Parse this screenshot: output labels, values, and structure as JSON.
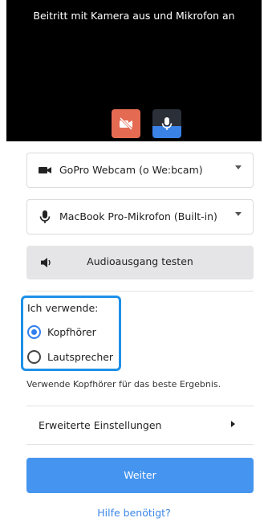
{
  "preview": {
    "title": "Beitritt mit Kamera aus und Mikrofon an",
    "camera_icon": "camera-off-icon",
    "mic_icon": "microphone-icon",
    "camera_button_color": "#e46b52",
    "mic_button_active_color": "#3b82e6"
  },
  "devices": {
    "camera_select": {
      "value": "GoPro Webcam (o We:bcam)",
      "icon": "video-camera-icon"
    },
    "microphone_select": {
      "value": "MacBook Pro-Mikrofon (Built-in)",
      "icon": "microphone-icon"
    },
    "audio_test": {
      "label": "Audioausgang testen",
      "icon": "speaker-icon"
    }
  },
  "usage": {
    "title": "Ich verwende:",
    "options": [
      {
        "label": "Kopfhörer",
        "selected": true
      },
      {
        "label": "Lautsprecher",
        "selected": false
      }
    ],
    "hint": "Verwende Kopfhörer für das beste Ergebnis.",
    "highlight_color": "#1e90e8"
  },
  "advanced": {
    "label": "Erweiterte Einstellungen"
  },
  "continue_button": {
    "label": "Weiter",
    "color": "#4594ef"
  },
  "help": {
    "label": "Hilfe benötigt?",
    "color": "#3b86e6"
  }
}
